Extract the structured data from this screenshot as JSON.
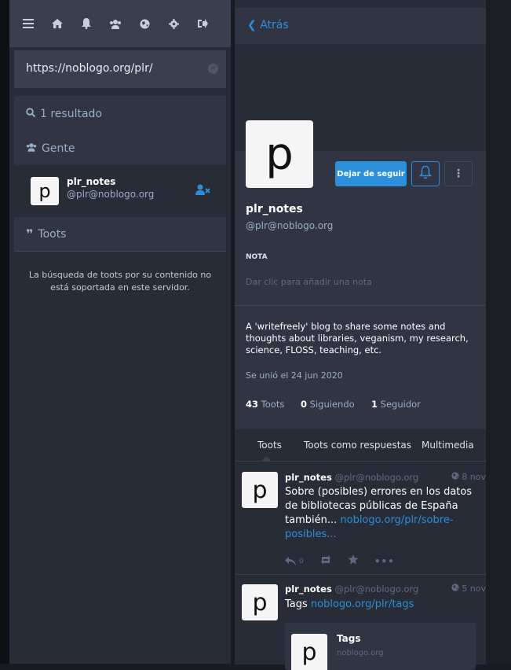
{
  "nav": {
    "icons": [
      "menu-icon",
      "home-icon",
      "bell-icon",
      "people-icon",
      "globe-icon",
      "gear-icon",
      "logout-icon"
    ]
  },
  "search": {
    "value": "https://noblogo.org/plr/"
  },
  "results": {
    "count_label": "1 resultado",
    "people_label": "Gente",
    "toots_label": "Toots",
    "no_support_msg": "La búsqueda de toots por su contenido no está soportada en este servidor."
  },
  "person": {
    "avatar_letter": "p",
    "name": "plr_notes",
    "handle": "@plr@noblogo.org"
  },
  "column": {
    "back_label": "Atrás"
  },
  "profile": {
    "avatar_letter": "p",
    "unfollow_label": "Dejar de seguir",
    "name": "plr_notes",
    "handle": "@plr@noblogo.org",
    "note_label": "NOTA",
    "note_placeholder": "Dar clic para añadir una nota",
    "bio": "A 'writefreely' blog to share some notes and thoughts about libraries, veganism, my research, science, FLOSS, teaching, etc.",
    "joined": "Se unió el 24 jun 2020",
    "stats": {
      "toots_count": "43",
      "toots_label": "Toots",
      "following_count": "0",
      "following_label": "Siguiendo",
      "followers_count": "1",
      "followers_label": "Seguidor"
    }
  },
  "tabs": [
    "Toots",
    "Toots como respuestas",
    "Multimedia"
  ],
  "statuses": [
    {
      "name": "plr_notes",
      "handle": "@plr@noblogo.org",
      "time": "8 nov",
      "text": "Sobre (posibles) errores en los datos de bibliotecas públicas de España también...",
      "link": "noblogo.org/plr/sobre-posibles...",
      "replies": "0"
    },
    {
      "name": "plr_notes",
      "handle": "@plr@noblogo.org",
      "time": "5 nov",
      "text": "Tags",
      "link": "noblogo.org/plr/tags",
      "card_title": "Tags",
      "card_domain": "noblogo.org",
      "card_letter": "p"
    }
  ],
  "colors": {
    "accent": "#2b90d9",
    "bg": "#282c37",
    "panel": "#313543",
    "header": "#393f4f"
  }
}
